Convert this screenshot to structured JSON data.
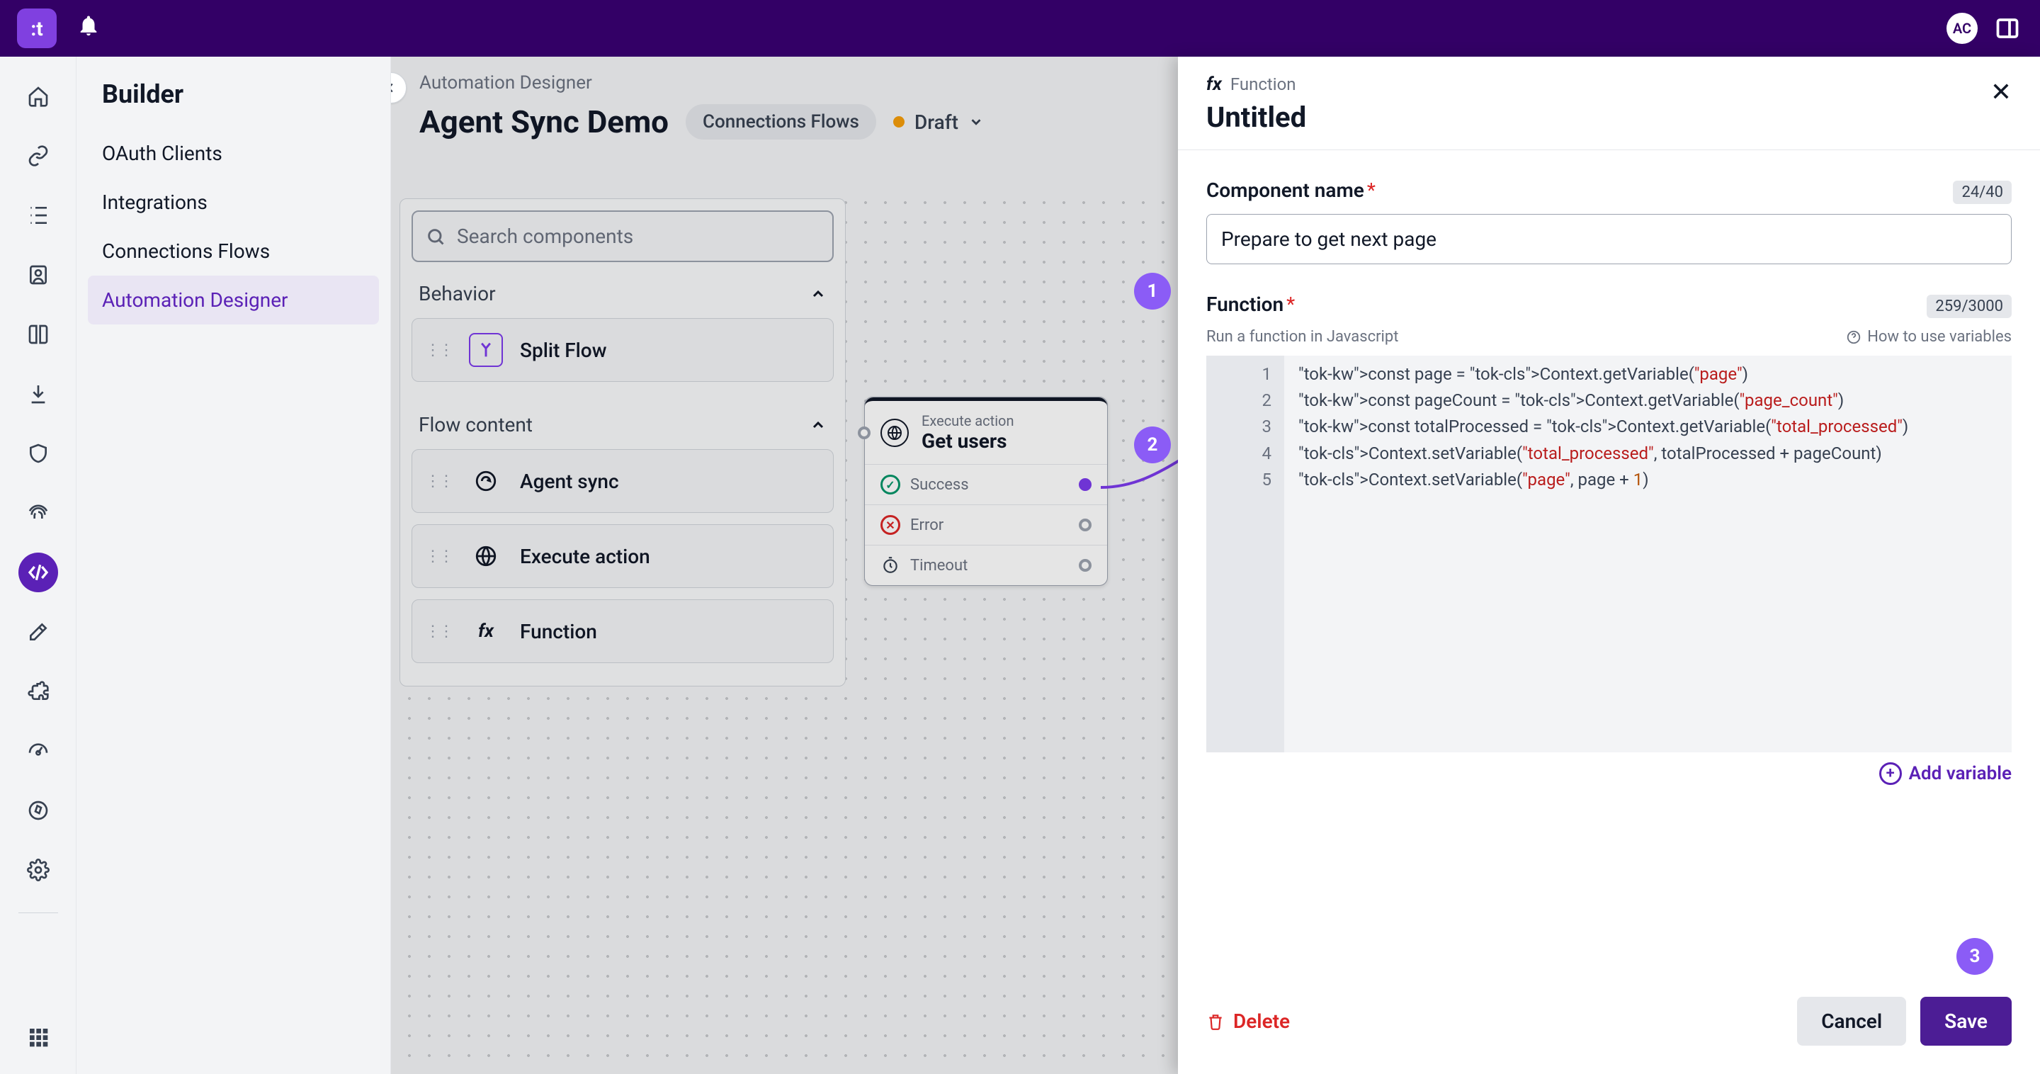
{
  "header": {
    "logo_text": ":t",
    "avatar_initials": "AC"
  },
  "sidebar": {
    "title": "Builder",
    "items": [
      {
        "label": "OAuth Clients"
      },
      {
        "label": "Integrations"
      },
      {
        "label": "Connections Flows"
      },
      {
        "label": "Automation Designer"
      }
    ],
    "active_index": 3
  },
  "page": {
    "breadcrumb": "Automation Designer",
    "title": "Agent Sync Demo",
    "chip": "Connections Flows",
    "status": "Draft"
  },
  "components_panel": {
    "search_placeholder": "Search components",
    "sections": [
      {
        "title": "Behavior",
        "items": [
          {
            "label": "Split Flow",
            "icon": "split"
          }
        ]
      },
      {
        "title": "Flow content",
        "items": [
          {
            "label": "Agent sync",
            "icon": "sync"
          },
          {
            "label": "Execute action",
            "icon": "globe"
          },
          {
            "label": "Function",
            "icon": "fx"
          }
        ]
      }
    ]
  },
  "canvas_node": {
    "overline": "Execute action",
    "title": "Get users",
    "outputs": [
      {
        "label": "Success",
        "type": "success",
        "connected": true
      },
      {
        "label": "Error",
        "type": "error",
        "connected": false
      },
      {
        "label": "Timeout",
        "type": "timeout",
        "connected": false
      }
    ]
  },
  "side_panel": {
    "type_label": "Function",
    "title": "Untitled",
    "name_field": {
      "label": "Component name",
      "value": "Prepare to get next page",
      "counter": "24/40"
    },
    "function_field": {
      "label": "Function",
      "sub": "Run a function in Javascript",
      "help_link": "How to use variables",
      "counter": "259/3000",
      "code_lines": [
        "const page = Context.getVariable(\"page\")",
        "const pageCount = Context.getVariable(\"page_count\")",
        "const totalProcessed = Context.getVariable(\"total_processed\")",
        "Context.setVariable(\"total_processed\", totalProcessed + pageCount)",
        "Context.setVariable(\"page\", page + 1)"
      ]
    },
    "add_variable_label": "Add variable",
    "delete_label": "Delete",
    "cancel_label": "Cancel",
    "save_label": "Save"
  },
  "annotations": [
    "1",
    "2",
    "3"
  ]
}
